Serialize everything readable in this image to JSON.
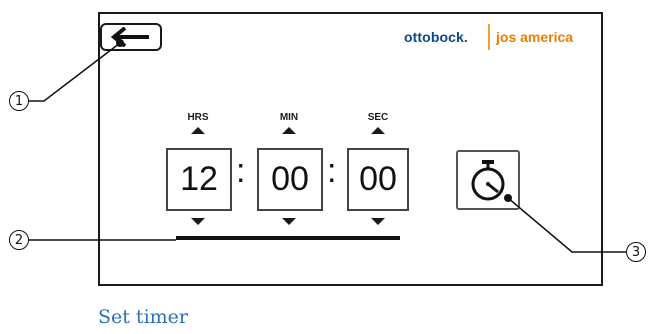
{
  "header": {
    "back_button_icon": "arrow-left-icon",
    "logo_brand": "ottobock.",
    "logo_product": "jos america"
  },
  "timer": {
    "hours_label": "HRS",
    "minutes_label": "MIN",
    "seconds_label": "SEC",
    "hours_value": "12",
    "minutes_value": "00",
    "seconds_value": "00",
    "separator": ":",
    "timer_button_icon": "stopwatch-icon"
  },
  "callouts": {
    "one": "1",
    "two": "2",
    "three": "3"
  },
  "caption": "Set timer",
  "colors": {
    "brand_blue": "#0b4a8a",
    "brand_orange": "#ef7d00",
    "caption_blue": "#2e6fb8"
  }
}
